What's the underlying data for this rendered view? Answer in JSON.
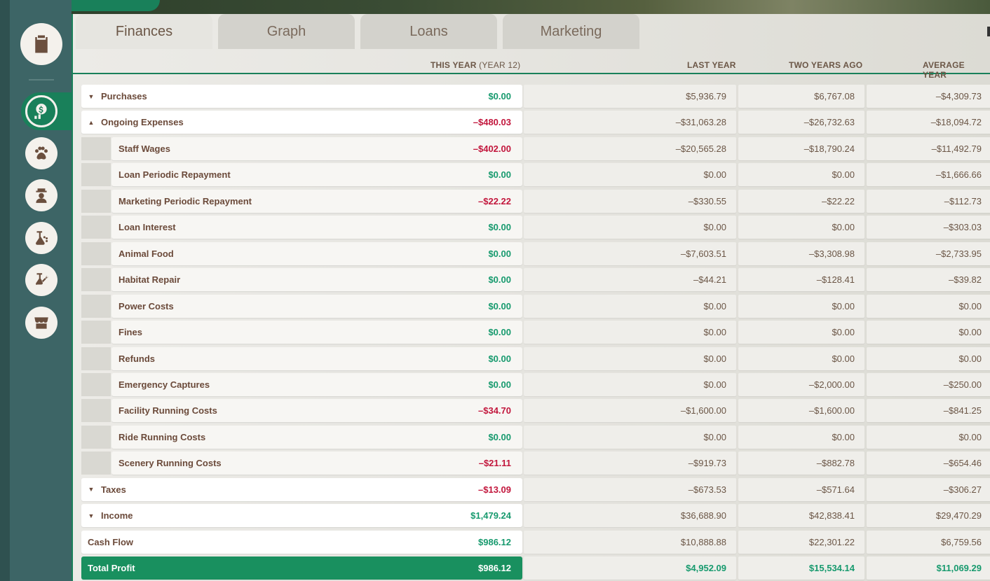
{
  "tabs": [
    {
      "label": "Finances",
      "active": true
    },
    {
      "label": "Graph",
      "active": false
    },
    {
      "label": "Loans",
      "active": false
    },
    {
      "label": "Marketing",
      "active": false
    }
  ],
  "columns": {
    "this_year": "THIS YEAR",
    "this_year_sub": "(YEAR 12)",
    "last_year": "LAST YEAR",
    "two_years_ago": "TWO YEARS AGO",
    "average_year": "AVERAGE YEAR"
  },
  "sidebar": {
    "items": [
      {
        "icon": "clipboard-icon"
      },
      {
        "icon": "finances-icon",
        "active": true
      },
      {
        "icon": "paw-icon"
      },
      {
        "icon": "staff-icon"
      },
      {
        "icon": "animal-care-icon"
      },
      {
        "icon": "maintenance-icon"
      },
      {
        "icon": "shop-icon"
      }
    ]
  },
  "colors": {
    "accent": "#19805a",
    "positive": "#179a6e",
    "negative": "#c2163c"
  },
  "rows": [
    {
      "label": "Purchases",
      "type": "section",
      "caret": "▼",
      "this_year": "$0.00",
      "this_year_sign": "pos",
      "last_year": "$5,936.79",
      "two_years_ago": "$6,767.08",
      "average": "–$4,309.73"
    },
    {
      "label": "Ongoing Expenses",
      "type": "section",
      "caret": "▲",
      "this_year": "–$480.03",
      "this_year_sign": "neg",
      "last_year": "–$31,063.28",
      "two_years_ago": "–$26,732.63",
      "average": "–$18,094.72"
    },
    {
      "label": "Staff Wages",
      "type": "sub",
      "this_year": "–$402.00",
      "this_year_sign": "neg",
      "last_year": "–$20,565.28",
      "two_years_ago": "–$18,790.24",
      "average": "–$11,492.79"
    },
    {
      "label": "Loan Periodic Repayment",
      "type": "sub",
      "this_year": "$0.00",
      "this_year_sign": "pos",
      "last_year": "$0.00",
      "two_years_ago": "$0.00",
      "average": "–$1,666.66"
    },
    {
      "label": "Marketing Periodic Repayment",
      "type": "sub",
      "this_year": "–$22.22",
      "this_year_sign": "neg",
      "last_year": "–$330.55",
      "two_years_ago": "–$22.22",
      "average": "–$112.73"
    },
    {
      "label": "Loan Interest",
      "type": "sub",
      "this_year": "$0.00",
      "this_year_sign": "pos",
      "last_year": "$0.00",
      "two_years_ago": "$0.00",
      "average": "–$303.03"
    },
    {
      "label": "Animal Food",
      "type": "sub",
      "this_year": "$0.00",
      "this_year_sign": "pos",
      "last_year": "–$7,603.51",
      "two_years_ago": "–$3,308.98",
      "average": "–$2,733.95"
    },
    {
      "label": "Habitat Repair",
      "type": "sub",
      "this_year": "$0.00",
      "this_year_sign": "pos",
      "last_year": "–$44.21",
      "two_years_ago": "–$128.41",
      "average": "–$39.82"
    },
    {
      "label": "Power Costs",
      "type": "sub",
      "this_year": "$0.00",
      "this_year_sign": "pos",
      "last_year": "$0.00",
      "two_years_ago": "$0.00",
      "average": "$0.00"
    },
    {
      "label": "Fines",
      "type": "sub",
      "this_year": "$0.00",
      "this_year_sign": "pos",
      "last_year": "$0.00",
      "two_years_ago": "$0.00",
      "average": "$0.00"
    },
    {
      "label": "Refunds",
      "type": "sub",
      "this_year": "$0.00",
      "this_year_sign": "pos",
      "last_year": "$0.00",
      "two_years_ago": "$0.00",
      "average": "$0.00"
    },
    {
      "label": "Emergency Captures",
      "type": "sub",
      "this_year": "$0.00",
      "this_year_sign": "pos",
      "last_year": "$0.00",
      "two_years_ago": "–$2,000.00",
      "average": "–$250.00"
    },
    {
      "label": "Facility Running Costs",
      "type": "sub",
      "this_year": "–$34.70",
      "this_year_sign": "neg",
      "last_year": "–$1,600.00",
      "two_years_ago": "–$1,600.00",
      "average": "–$841.25"
    },
    {
      "label": "Ride Running Costs",
      "type": "sub",
      "this_year": "$0.00",
      "this_year_sign": "pos",
      "last_year": "$0.00",
      "two_years_ago": "$0.00",
      "average": "$0.00"
    },
    {
      "label": "Scenery Running Costs",
      "type": "sub",
      "this_year": "–$21.11",
      "this_year_sign": "neg",
      "last_year": "–$919.73",
      "two_years_ago": "–$882.78",
      "average": "–$654.46"
    },
    {
      "label": "Taxes",
      "type": "section",
      "caret": "▼",
      "this_year": "–$13.09",
      "this_year_sign": "neg",
      "last_year": "–$673.53",
      "two_years_ago": "–$571.64",
      "average": "–$306.27"
    },
    {
      "label": "Income",
      "type": "section",
      "caret": "▼",
      "this_year": "$1,479.24",
      "this_year_sign": "pos",
      "last_year": "$36,688.90",
      "two_years_ago": "$42,838.41",
      "average": "$29,470.29"
    },
    {
      "label": "Cash Flow",
      "type": "plain",
      "this_year": "$986.12",
      "this_year_sign": "pos",
      "last_year": "$10,888.88",
      "two_years_ago": "$22,301.22",
      "average": "$6,759.56"
    },
    {
      "label": "Total Profit",
      "type": "total",
      "this_year": "$986.12",
      "this_year_sign": "pos",
      "last_year": "$4,952.09",
      "two_years_ago": "$15,534.14",
      "average": "$11,069.29"
    }
  ]
}
